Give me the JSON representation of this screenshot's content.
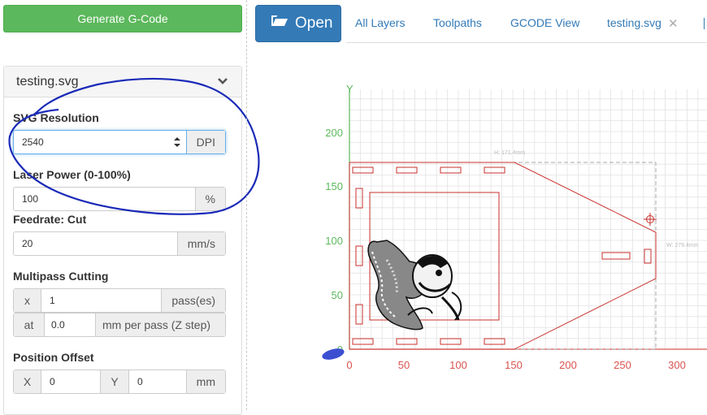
{
  "left_panel": {
    "generate_label": "Generate G-Code",
    "file_title": "testing.svg",
    "svg_resolution": {
      "label": "SVG Resolution",
      "value": "2540",
      "unit": "DPI"
    },
    "laser_power": {
      "label": "Laser Power (0-100%)",
      "value": "100",
      "unit": "%"
    },
    "feedrate": {
      "label": "Feedrate: Cut",
      "value": "20",
      "unit": "mm/s"
    },
    "multipass": {
      "label": "Multipass Cutting",
      "x_prefix": "x",
      "passes": "1",
      "passes_unit": "pass(es)",
      "at_prefix": "at",
      "step": "0.0",
      "step_unit": "mm per pass (Z step)"
    },
    "offset": {
      "label": "Position Offset",
      "x_label": "X",
      "x_value": "0",
      "y_label": "Y",
      "y_value": "0",
      "unit": "mm"
    }
  },
  "nav": {
    "open_label": "Open",
    "tabs": [
      "All Layers",
      "Toolpaths",
      "GCODE View",
      "testing.svg"
    ]
  },
  "viewer": {
    "y_axis_label": "Y",
    "y_ticks": [
      "200",
      "150",
      "100",
      "50",
      "0"
    ],
    "x_ticks": [
      "0",
      "50",
      "100",
      "150",
      "200",
      "250",
      "300"
    ],
    "width_dim_label": "W: 279.4mm",
    "height_dim_label": "H: 171.4mm",
    "colors": {
      "grid": "#e3e3e3",
      "x_axis": "#d9534f",
      "y_axis": "#5cb85c",
      "job": "#c9302c"
    }
  }
}
